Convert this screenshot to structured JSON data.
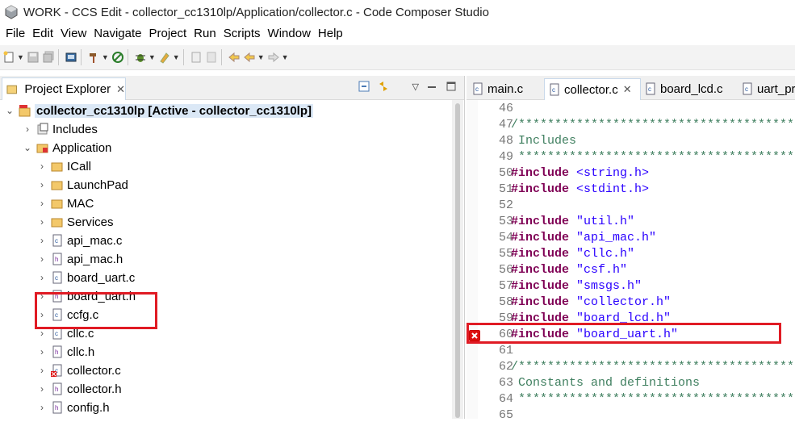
{
  "window": {
    "title": "WORK - CCS Edit - collector_cc1310lp/Application/collector.c - Code Composer Studio"
  },
  "menu": [
    "File",
    "Edit",
    "View",
    "Navigate",
    "Project",
    "Run",
    "Scripts",
    "Window",
    "Help"
  ],
  "project_explorer": {
    "tab_label": "Project Explorer",
    "project": "collector_cc1310lp  [Active - collector_cc1310lp]",
    "items": [
      {
        "label": "Includes",
        "type": "includes"
      },
      {
        "label": "Application",
        "type": "folder-open"
      },
      {
        "label": "ICall",
        "type": "folder"
      },
      {
        "label": "LaunchPad",
        "type": "folder"
      },
      {
        "label": "MAC",
        "type": "folder"
      },
      {
        "label": "Services",
        "type": "folder"
      },
      {
        "label": "api_mac.c",
        "type": "c-file"
      },
      {
        "label": "api_mac.h",
        "type": "h-file"
      },
      {
        "label": "board_uart.c",
        "type": "c-file"
      },
      {
        "label": "board_uart.h",
        "type": "h-file"
      },
      {
        "label": "ccfg.c",
        "type": "c-file"
      },
      {
        "label": "cllc.c",
        "type": "c-file"
      },
      {
        "label": "cllc.h",
        "type": "h-file"
      },
      {
        "label": "collector.c",
        "type": "c-file-error"
      },
      {
        "label": "collector.h",
        "type": "h-file"
      },
      {
        "label": "config.h",
        "type": "h-file"
      }
    ]
  },
  "editor": {
    "tabs": [
      "main.c",
      "collector.c",
      "board_lcd.c",
      "uart_pr"
    ],
    "active_tab": "collector.c",
    "lines": [
      {
        "n": "46",
        "kind": "blank",
        "text": ""
      },
      {
        "n": "47",
        "kind": "comment",
        "text": "/******************************************"
      },
      {
        "n": "48",
        "kind": "comment",
        "text": " Includes"
      },
      {
        "n": "49",
        "kind": "comment",
        "text": " *****************************************"
      },
      {
        "n": "50",
        "kind": "include",
        "directive": "#include",
        "target": " <string.h>"
      },
      {
        "n": "51",
        "kind": "include",
        "directive": "#include",
        "target": " <stdint.h>"
      },
      {
        "n": "52",
        "kind": "blank",
        "text": ""
      },
      {
        "n": "53",
        "kind": "include",
        "directive": "#include",
        "target": " \"util.h\""
      },
      {
        "n": "54",
        "kind": "include",
        "directive": "#include",
        "target": " \"api_mac.h\""
      },
      {
        "n": "55",
        "kind": "include",
        "directive": "#include",
        "target": " \"cllc.h\""
      },
      {
        "n": "56",
        "kind": "include",
        "directive": "#include",
        "target": " \"csf.h\""
      },
      {
        "n": "57",
        "kind": "include",
        "directive": "#include",
        "target": " \"smsgs.h\""
      },
      {
        "n": "58",
        "kind": "include",
        "directive": "#include",
        "target": " \"collector.h\""
      },
      {
        "n": "59",
        "kind": "include",
        "directive": "#include",
        "target": " \"board_lcd.h\""
      },
      {
        "n": "60",
        "kind": "include",
        "directive": "#include",
        "target": " \"board_uart.h\"",
        "error": true
      },
      {
        "n": "61",
        "kind": "blank",
        "text": ""
      },
      {
        "n": "62",
        "kind": "comment",
        "text": "/******************************************"
      },
      {
        "n": "63",
        "kind": "comment",
        "text": " Constants and definitions"
      },
      {
        "n": "64",
        "kind": "comment",
        "text": " *****************************************"
      },
      {
        "n": "65",
        "kind": "blank",
        "text": ""
      }
    ]
  },
  "colors": {
    "highlight": "#e01b24",
    "keyword": "#7f0055",
    "string": "#2a00ff",
    "comment": "#3f7f5f"
  }
}
